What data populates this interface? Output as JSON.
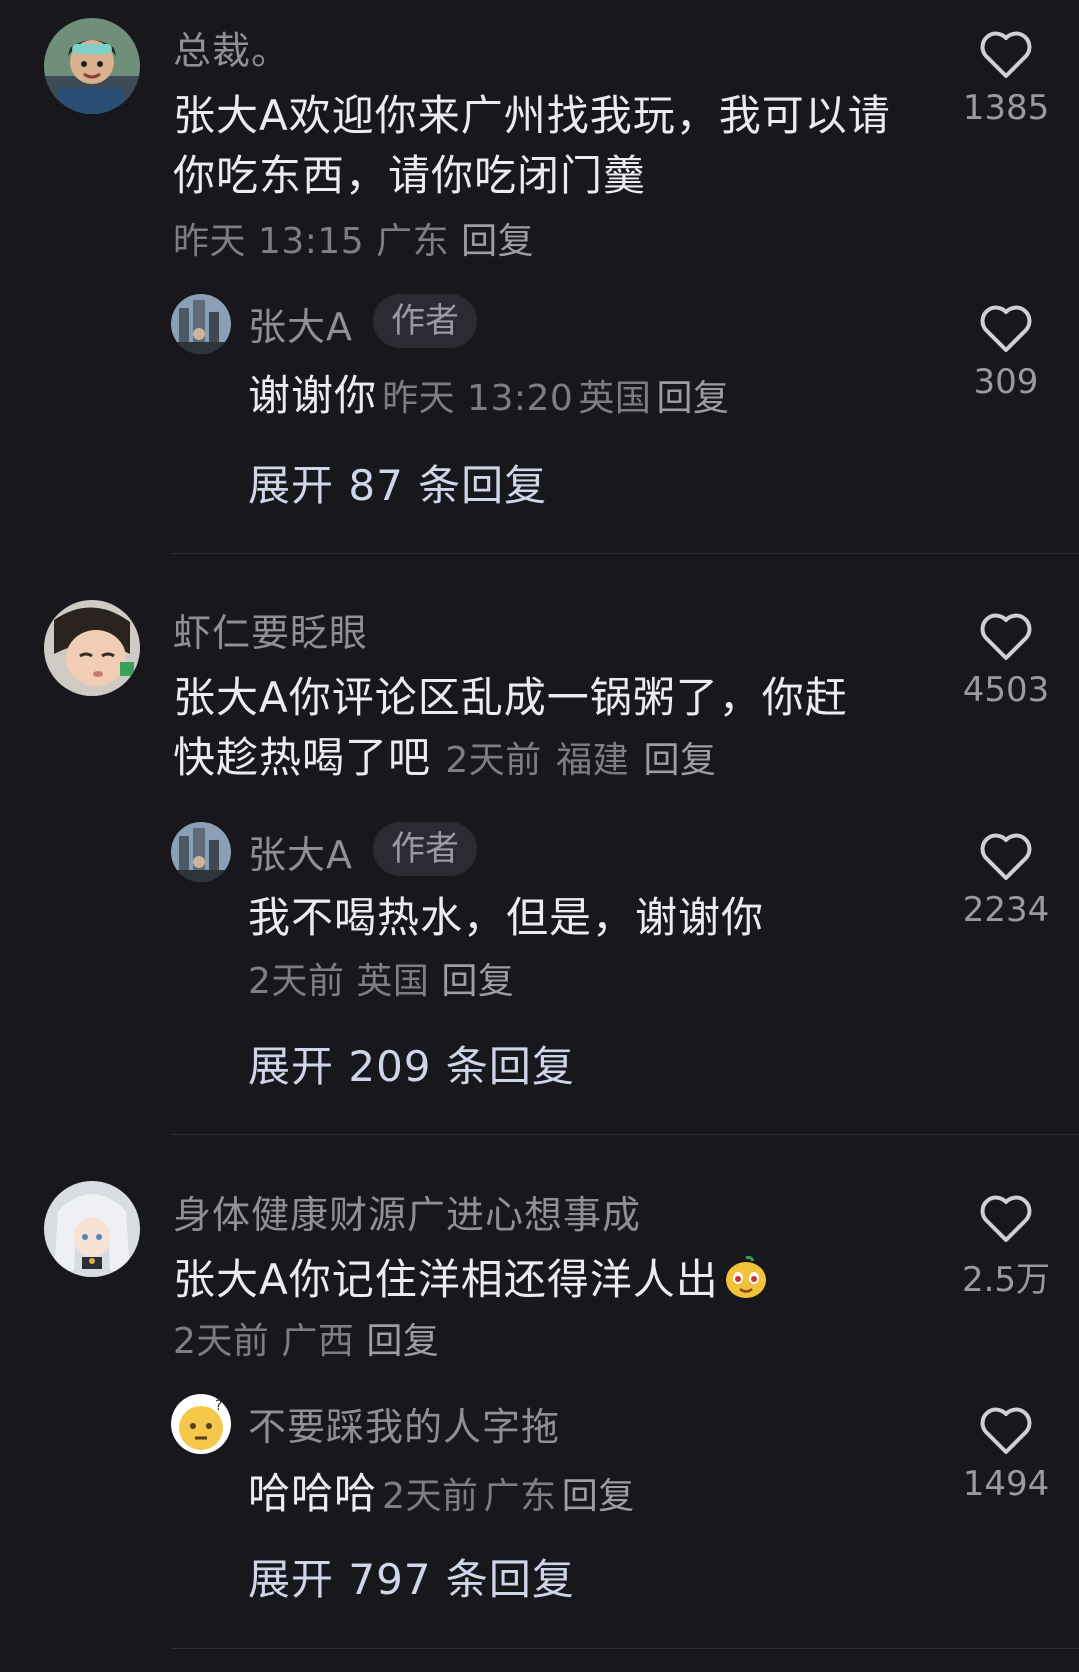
{
  "comments": [
    {
      "username": "总裁。",
      "text": "张大A欢迎你来广州找我玩，我可以请你吃东西，请你吃闭门羹",
      "time": "昨天 13:15",
      "location": "广东",
      "reply": "回复",
      "likes": "1385",
      "avatar_icon": "person-avatar",
      "author_reply": {
        "username": "张大A",
        "tag": "作者",
        "text": "谢谢你",
        "time": "昨天 13:20",
        "location": "英国",
        "reply": "回复",
        "likes": "309"
      },
      "expand": "展开 87 条回复"
    },
    {
      "username": "虾仁要眨眼",
      "text_line1": "张大A你评论区乱成一锅粥了，你赶",
      "text_line2": "快趁热喝了吧",
      "time": "2天前",
      "location": "福建",
      "reply": "回复",
      "likes": "4503",
      "author_reply": {
        "username": "张大A",
        "tag": "作者",
        "text": "我不喝热水，但是，谢谢你",
        "time": "2天前",
        "location": "英国",
        "reply": "回复",
        "likes": "2234"
      },
      "expand": "展开 209 条回复"
    },
    {
      "username": "身体健康财源广进心想事成",
      "text": "张大A你记住洋相还得洋人出",
      "time": "2天前",
      "location": "广西",
      "reply": "回复",
      "likes": "2.5万",
      "sub_reply": {
        "username": "不要踩我的人字拖",
        "text": "哈哈哈",
        "time": "2天前",
        "location": "广东",
        "reply": "回复",
        "likes": "1494"
      },
      "expand": "展开 797 条回复"
    }
  ],
  "colors": {
    "background": "#17171c",
    "text": "#ececf0",
    "muted": "#7d7d86",
    "expand": "#cfd6ea"
  }
}
